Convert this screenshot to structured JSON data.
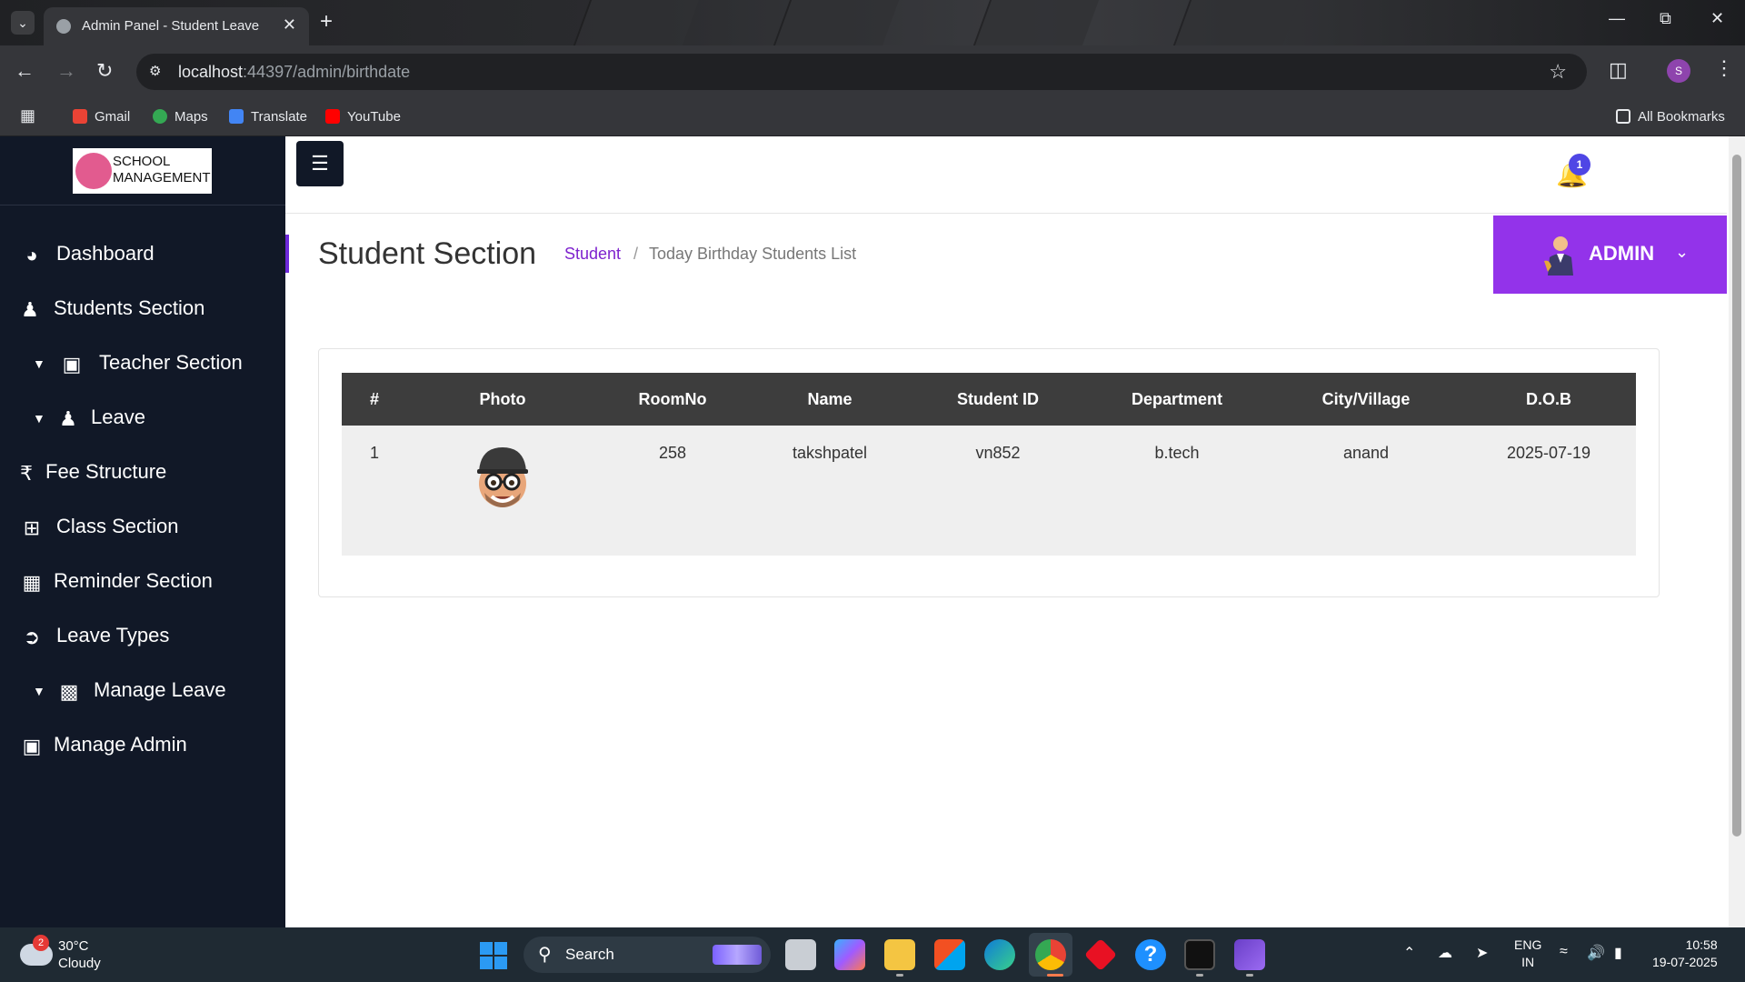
{
  "browser": {
    "tab_title": "Admin Panel - Student Leave",
    "url_host": "localhost",
    "url_path": ":44397/admin/birthdate",
    "profile_initial": "S",
    "bookmarks": [
      "Gmail",
      "Maps",
      "Translate",
      "YouTube"
    ],
    "all_bookmarks": "All Bookmarks"
  },
  "sidebar": {
    "logo_line1": "SCHOOL",
    "logo_line2": "MANAGEMENT",
    "items": [
      {
        "label": "Dashboard",
        "icon": "gauge-icon"
      },
      {
        "label": "Students Section",
        "icon": "user-icon"
      },
      {
        "label": "Teacher Section",
        "icon": "chalkboard-teacher-icon"
      },
      {
        "label": "Leave",
        "icon": "user-icon"
      },
      {
        "label": "Fee Structure",
        "icon": "rupee-icon"
      },
      {
        "label": "Class Section",
        "icon": "table-icon"
      },
      {
        "label": "Reminder Section",
        "icon": "calendar-icon"
      },
      {
        "label": "Leave Types",
        "icon": "sign-out-icon"
      },
      {
        "label": "Manage Leave",
        "icon": "briefcase-icon"
      },
      {
        "label": "Manage Admin",
        "icon": "lock-icon"
      }
    ]
  },
  "topbar": {
    "notification_count": "1"
  },
  "header": {
    "title": "Student Section",
    "breadcrumb_link": "Student",
    "breadcrumb_sep": "/",
    "breadcrumb_current": "Today Birthday Students List",
    "admin_label": "ADMIN"
  },
  "table": {
    "columns": [
      "#",
      "Photo",
      "RoomNo",
      "Name",
      "Student ID",
      "Department",
      "City/Village",
      "D.O.B"
    ],
    "rows": [
      {
        "num": "1",
        "room": "258",
        "name": "takshpatel",
        "student_id": "vn852",
        "department": "b.tech",
        "city": "anand",
        "dob": "2025-07-19"
      }
    ]
  },
  "taskbar": {
    "weather_badge": "2",
    "temperature": "30°C",
    "weather_desc": "Cloudy",
    "search_label": "Search",
    "lang_line1": "ENG",
    "lang_line2": "IN",
    "time": "10:58",
    "date": "19-07-2025"
  },
  "colors": {
    "sidebar_bg": "#111827",
    "accent_purple": "#9333ea",
    "breadcrumb_link": "#7e22ce",
    "table_header_bg": "#3d3d3d"
  }
}
